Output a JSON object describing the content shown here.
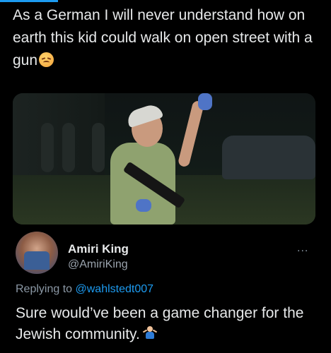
{
  "tweet": {
    "text": "As a German I will never understand how on earth this kid could walk on open street with a gun",
    "emoji": "persevering-face"
  },
  "reply": {
    "author_name": "Amiri King",
    "author_handle": "@AmiriKing",
    "replying_prefix": "Replying to",
    "replying_to": "@wahlstedt007",
    "more": "...",
    "text": "Sure would’ve been a game changer for the Jewish community.",
    "emoji": "person-shrugging"
  },
  "colors": {
    "background": "#000000",
    "text": "#e7e9ea",
    "muted": "#8b98a5",
    "accent": "#1d9bf0"
  }
}
